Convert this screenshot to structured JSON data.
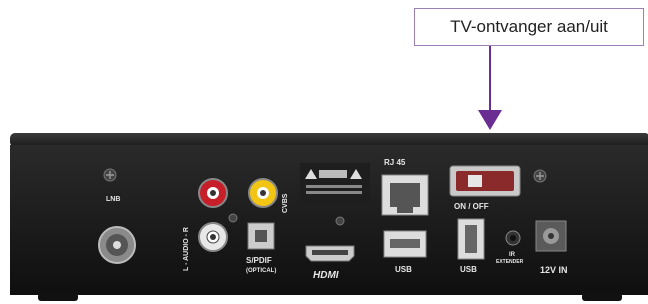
{
  "callout": {
    "label": "TV-ontvanger aan/uit"
  },
  "ports": {
    "lnb": "LNB",
    "audio": "L - AUDIO - R",
    "cvbs": "CVBS",
    "spdif": "S/PDIF",
    "spdif_sub": "(OPTICAL)",
    "hdmi": "HDMI",
    "rj45": "RJ 45",
    "on_off": "ON / OFF",
    "usb1": "USB",
    "usb2": "USB",
    "ir": "IR",
    "ir_sub": "EXTENDER",
    "power": "12V IN"
  },
  "colors": {
    "accent": "#6a2d91",
    "callout_border": "#9b7fb5"
  }
}
